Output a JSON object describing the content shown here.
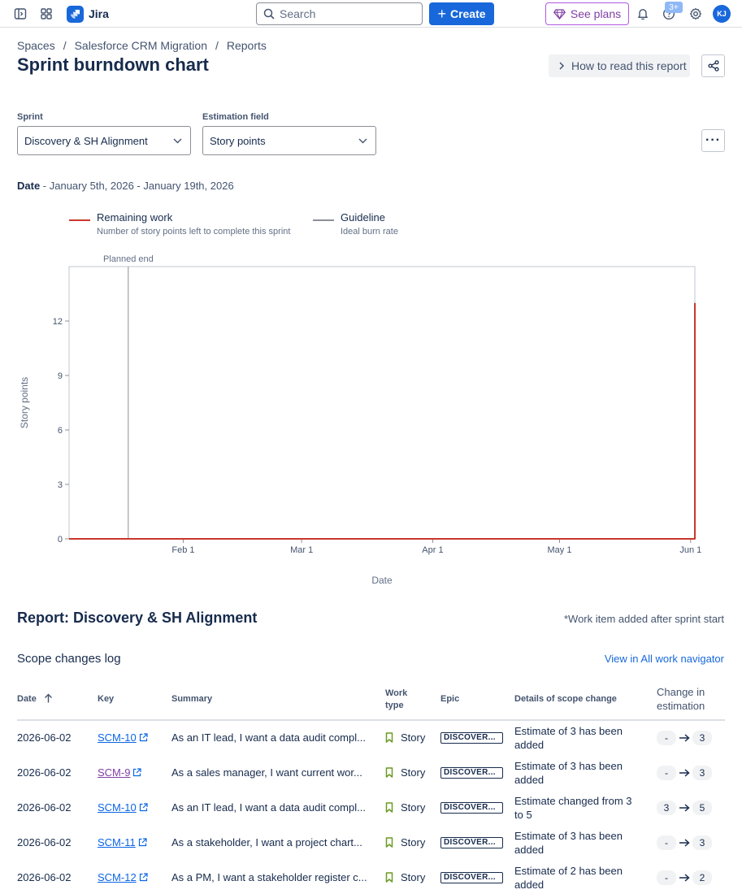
{
  "topbar": {
    "app_name": "Jira",
    "search_placeholder": "Search",
    "create_label": "Create",
    "see_plans_label": "See plans",
    "help_badge": "3+",
    "avatar_initials": "KJ",
    "icons": [
      "sidebar-toggle-icon",
      "app-switcher-icon",
      "search-icon",
      "bell-icon",
      "help-icon",
      "gear-icon"
    ]
  },
  "breadcrumb": [
    "Spaces",
    "Salesforce CRM Migration",
    "Reports"
  ],
  "page": {
    "title": "Sprint burndown chart",
    "how_to_label": "How to read this report"
  },
  "filters": {
    "sprint_label": "Sprint",
    "sprint_value": "Discovery & SH Alignment",
    "estimation_label": "Estimation field",
    "estimation_value": "Story points"
  },
  "date_range": {
    "label": "Date",
    "value": " - January 5th, 2026 - January 19th, 2026"
  },
  "legend": [
    {
      "title": "Remaining work",
      "subtitle": "Number of story points left to complete this sprint",
      "color": "#c9372c"
    },
    {
      "title": "Guideline",
      "subtitle": "Ideal burn rate",
      "color": "#8c8f97"
    }
  ],
  "chart_data": {
    "type": "line",
    "xlabel": "Date",
    "ylabel": "Story points",
    "x_ticks": [
      "Feb 1",
      "Mar 1",
      "Apr 1",
      "May 1",
      "Jun 1"
    ],
    "x_range": [
      "2026-01-05",
      "2026-06-02"
    ],
    "ylim": [
      0,
      15
    ],
    "y_ticks": [
      0,
      3,
      6,
      9,
      12
    ],
    "grid": false,
    "annotations": [
      {
        "label": "Planned end",
        "x": "2026-01-19"
      }
    ],
    "series": [
      {
        "name": "Remaining work",
        "color": "#c9372c",
        "points": [
          {
            "x": "2026-01-05",
            "y": 0
          },
          {
            "x": "2026-06-02",
            "y": 0
          },
          {
            "x": "2026-06-02",
            "y": 13
          }
        ]
      }
    ]
  },
  "report": {
    "title": "Report: Discovery & SH Alignment",
    "note": "*Work item added after sprint start",
    "scope_title": "Scope changes log",
    "nav_link": "View in All work navigator",
    "columns": {
      "date": "Date",
      "key": "Key",
      "summary": "Summary",
      "work_type": "Work type",
      "epic": "Epic",
      "details": "Details of scope change",
      "change": "Change in estimation"
    },
    "rows": [
      {
        "date": "2026-06-02",
        "key": "SCM-10",
        "summary": "As an IT lead, I want a data audit compl...",
        "type": "Story",
        "epic": "DISCOVER...",
        "details": "Estimate of 3 has been added",
        "from": "-",
        "to": "3"
      },
      {
        "date": "2026-06-02",
        "key": "SCM-9",
        "summary": "As a sales manager, I want current wor...",
        "type": "Story",
        "epic": "DISCOVER...",
        "details": "Estimate of 3 has been added",
        "from": "-",
        "to": "3"
      },
      {
        "date": "2026-06-02",
        "key": "SCM-10",
        "summary": "As an IT lead, I want a data audit compl...",
        "type": "Story",
        "epic": "DISCOVER...",
        "details": "Estimate changed from 3 to 5",
        "from": "3",
        "to": "5"
      },
      {
        "date": "2026-06-02",
        "key": "SCM-11",
        "summary": "As a stakeholder, I want a project chart...",
        "type": "Story",
        "epic": "DISCOVER...",
        "details": "Estimate of 3 has been added",
        "from": "-",
        "to": "3"
      },
      {
        "date": "2026-06-02",
        "key": "SCM-12",
        "summary": "As a PM, I want a stakeholder register c...",
        "type": "Story",
        "epic": "DISCOVER...",
        "details": "Estimate of 2 has been added",
        "from": "-",
        "to": "2"
      }
    ]
  }
}
